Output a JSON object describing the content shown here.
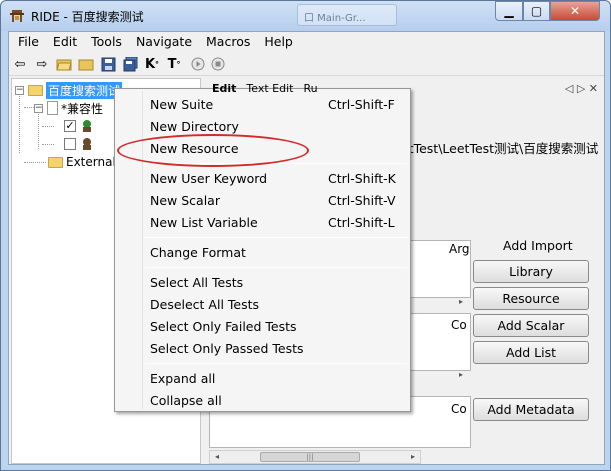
{
  "window": {
    "title": "RIDE - 百度搜索测试",
    "ghost_tab": "口 Main-Gr..."
  },
  "menubar": [
    "File",
    "Edit",
    "Tools",
    "Navigate",
    "Macros",
    "Help"
  ],
  "toolbar": {
    "text_buttons": [
      "K",
      "T"
    ]
  },
  "tree": {
    "root": "百度搜索测试",
    "child": "*兼容性",
    "test1_check": "✓",
    "external": "External R"
  },
  "right_panel": {
    "tab1": "Edit",
    "tab2": "Text Edit",
    "tab3": "Ru",
    "path": "etTest\\LeetTest测试\\百度搜索测试",
    "col_arg": "Arg",
    "col_co1": "Co",
    "col_co2": "Co",
    "add_import_label": "Add Import",
    "buttons": {
      "library": "Library",
      "resource": "Resource",
      "add_scalar": "Add Scalar",
      "add_list": "Add List",
      "add_metadata": "Add Metadata"
    }
  },
  "context_menu": {
    "items": [
      {
        "label": "New Suite",
        "shortcut": "Ctrl-Shift-F"
      },
      {
        "label": "New Directory",
        "shortcut": ""
      },
      {
        "label": "New Resource",
        "shortcut": ""
      },
      {
        "label": "New User Keyword",
        "shortcut": "Ctrl-Shift-K"
      },
      {
        "label": "New Scalar",
        "shortcut": "Ctrl-Shift-V"
      },
      {
        "label": "New List Variable",
        "shortcut": "Ctrl-Shift-L"
      },
      {
        "label": "Change Format",
        "shortcut": ""
      },
      {
        "label": "Select All Tests",
        "shortcut": ""
      },
      {
        "label": "Deselect All Tests",
        "shortcut": ""
      },
      {
        "label": "Select Only Failed Tests",
        "shortcut": ""
      },
      {
        "label": "Select Only Passed Tests",
        "shortcut": ""
      },
      {
        "label": "Expand all",
        "shortcut": ""
      },
      {
        "label": "Collapse all",
        "shortcut": ""
      }
    ]
  },
  "colors": {
    "selection": "#3399ff",
    "annotation": "#d42a2a",
    "close_button": "#c74b36"
  }
}
